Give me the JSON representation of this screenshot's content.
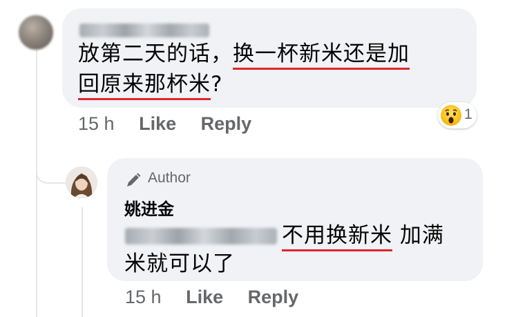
{
  "comment": {
    "text_line1_prefix": "放第二天的话，",
    "text_line1_highlight": "换一杯新米还是加",
    "text_line2_highlight": "回原来那杯米",
    "text_line2_suffix": "?",
    "time": "15 h",
    "like_label": "Like",
    "reply_label": "Reply",
    "reaction_count": "1",
    "reaction_icon": "wow-emoji-icon"
  },
  "reply": {
    "badge_icon": "pencil-icon",
    "badge_label": "Author",
    "author_name": "姚进金",
    "text_highlight": "不用换新米",
    "text_rest1": " 加满",
    "text_line2": "米就可以了",
    "time": "15 h",
    "like_label": "Like",
    "reply_label": "Reply"
  },
  "colors": {
    "bubble": "#f0f2f5",
    "underline": "#e0242b",
    "meta": "#65676b"
  }
}
